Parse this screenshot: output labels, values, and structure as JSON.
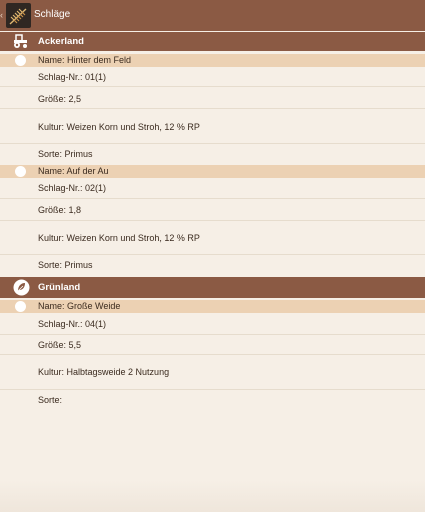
{
  "appbar": {
    "title": "Schläge",
    "back_icon": "chevron-left-icon",
    "logo_icon": "wheat-logo-icon"
  },
  "colors": {
    "appbar": "#8b5a44",
    "section_header": "#8b5a44",
    "name_row": "#ecd1b3",
    "background": "#f6efe6"
  },
  "sections": [
    {
      "title": "Ackerland",
      "icon": "tractor-icon",
      "fields": [
        {
          "name": "Name: Hinter dem Feld",
          "schlag_nr": "Schlag-Nr.: 01(1)",
          "groesse": "Größe: 2,5",
          "kultur": "Kultur: Weizen Korn und Stroh, 12 % RP",
          "sorte": "Sorte: Primus"
        },
        {
          "name": "Name: Auf der Au",
          "schlag_nr": "Schlag-Nr.: 02(1)",
          "groesse": "Größe: 1,8",
          "kultur": "Kultur: Weizen Korn und Stroh, 12 % RP",
          "sorte": "Sorte: Primus"
        }
      ]
    },
    {
      "title": "Grünland",
      "icon": "leaf-icon",
      "fields": [
        {
          "name": "Name: Große Weide",
          "schlag_nr": "Schlag-Nr.: 04(1)",
          "groesse": "Größe: 5,5",
          "kultur": "Kultur: Halbtagsweide 2 Nutzung",
          "sorte": "Sorte:"
        }
      ]
    }
  ]
}
